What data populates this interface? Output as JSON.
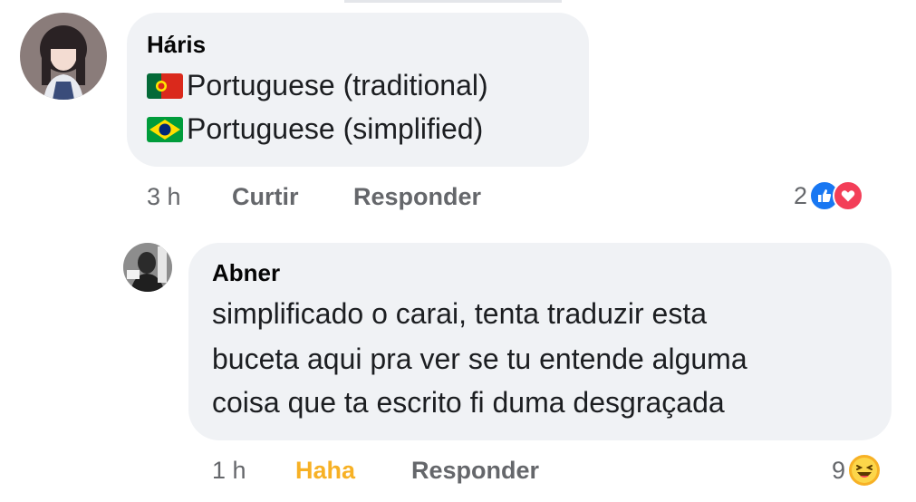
{
  "comments": [
    {
      "author": "Háris",
      "lines": [
        {
          "flag": "portugal-flag",
          "text": "Portuguese (traditional)"
        },
        {
          "flag": "brazil-flag",
          "text": "Portuguese (simplified)"
        }
      ],
      "time": "3 h",
      "actions": {
        "react": "Curtir",
        "reply": "Responder"
      },
      "reactions": {
        "count": "2",
        "icons": [
          "like-icon",
          "love-icon"
        ]
      }
    },
    {
      "author": "Abner",
      "lines": [
        {
          "text": "simplificado o carai, tenta traduzir esta"
        },
        {
          "text": "buceta aqui pra ver se tu entende alguma"
        },
        {
          "text": "coisa que ta escrito fi duma desgraçada"
        }
      ],
      "time": "1 h",
      "actions": {
        "react": "Haha",
        "reply": "Responder"
      },
      "reactions": {
        "count": "9",
        "icons": [
          "haha-icon"
        ]
      }
    }
  ],
  "colors": {
    "bubble": "#f0f2f5",
    "secondary_text": "#65676b",
    "haha_accent": "#f7b125",
    "like_blue": "#1877f2",
    "love_red": "#f33e58"
  }
}
